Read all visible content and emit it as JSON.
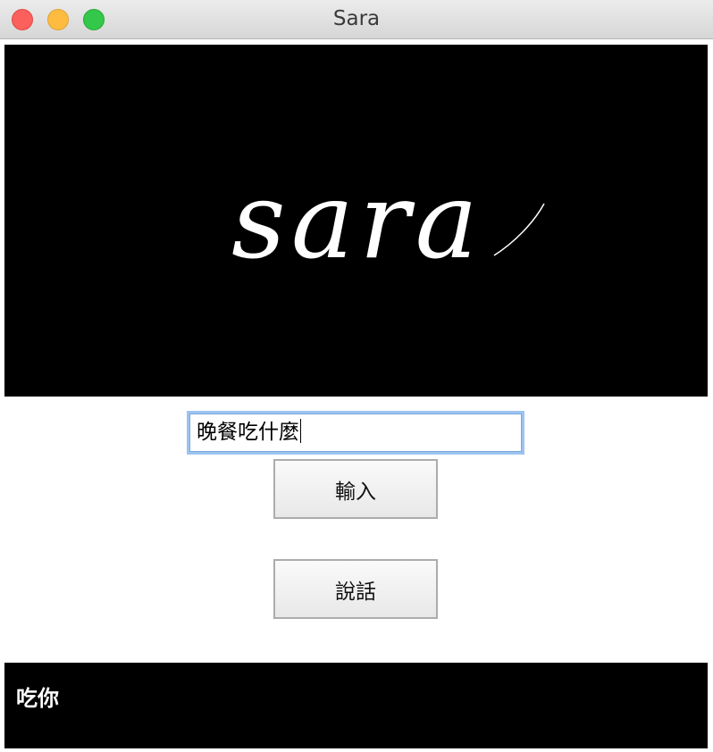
{
  "window": {
    "title": "Sara",
    "controls": [
      "close-icon",
      "minimize-icon",
      "zoom-icon"
    ]
  },
  "banner": {
    "logo_text": "sara",
    "background": "#000000",
    "logo_color": "#ffffff"
  },
  "input": {
    "value": "晚餐吃什麼",
    "focus_color": "#9cc4f0"
  },
  "buttons": {
    "submit_label": "輸入",
    "speak_label": "說話"
  },
  "reply": {
    "text": "吃你"
  }
}
